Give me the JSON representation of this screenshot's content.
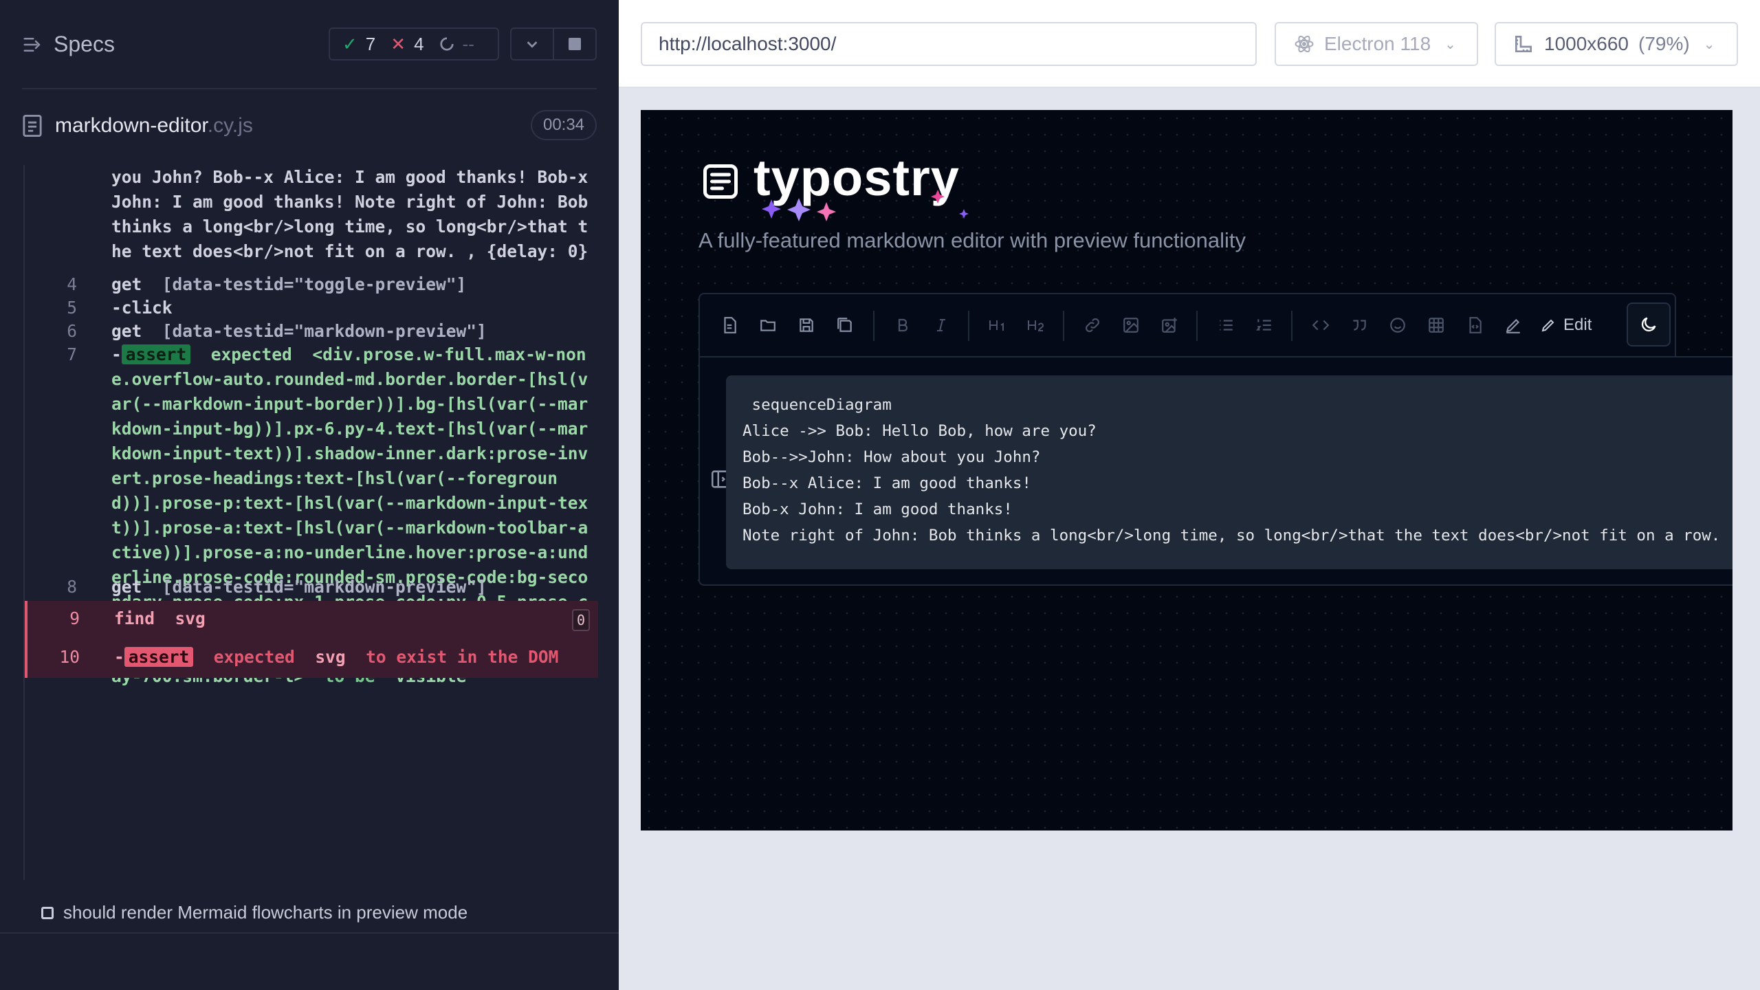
{
  "reporter": {
    "title": "Specs",
    "stats": {
      "passed": "7",
      "failed": "4",
      "pending": "--"
    },
    "file": {
      "name": "markdown-editor",
      "ext": ".cy.js",
      "duration": "00:34"
    },
    "commands": [
      {
        "text": "you John? Bob--x Alice: I am good thanks! Bob-x John: I am good thanks! Note right of John: Bob thinks a long<br/>long time, so long<br/>that the text does<br/>not fit on a row. , {delay: 0}"
      },
      {
        "num": "4",
        "name": "get",
        "arg": "[data-testid=\"toggle-preview\"]"
      },
      {
        "num": "5",
        "name": "-click"
      },
      {
        "num": "6",
        "name": "get",
        "arg": "[data-testid=\"markdown-preview\"]"
      },
      {
        "num": "7",
        "prefix": "-",
        "badge": "assert",
        "expected": "expected",
        "subject": "<div.prose.w-full.max-w-none.overflow-auto.rounded-md.border.border-[hsl(var(--markdown-input-border))].bg-[hsl(var(--markdown-input-bg))].px-6.py-4.text-[hsl(var(--markdown-input-text))].shadow-inner.dark:prose-invert.prose-headings:text-[hsl(var(--foreground))].prose-p:text-[hsl(var(--markdown-input-text))].prose-a:text-[hsl(var(--markdown-toolbar-active))].prose-a:no-underline.hover:prose-a:underline.prose-code:rounded-sm.prose-code:bg-secondary.prose-code:px-1.prose-code:py-0.5.prose-code:text-[hsl(var(--foreground))].prose-pre:bg-muted.prose-pre:shadow-sm.flex-1.dark:border-gray-700.sm:border-l>",
        "tobe": "to be",
        "state": "visible"
      },
      {
        "num": "8",
        "name": "get",
        "arg": "[data-testid=\"markdown-preview\"]"
      },
      {
        "num": "9",
        "name": "find",
        "arg": "svg",
        "count": "0"
      },
      {
        "num": "10",
        "prefix": "-",
        "badge": "assert",
        "expected": "expected",
        "subject": "svg",
        "rest": "to exist in the DOM"
      }
    ],
    "next_test": "should render Mermaid flowcharts in preview mode"
  },
  "browser": {
    "url": "http://localhost:3000/",
    "engine": "Electron 118",
    "viewport": "1000x660",
    "zoom": "(79%)"
  },
  "app": {
    "title": "typostry",
    "subtitle": "A fully-featured markdown editor with preview functionality",
    "toolbar": {
      "icons": [
        "new-file-icon",
        "open-folder-icon",
        "save-icon",
        "save-as-icon",
        "bold-icon",
        "italic-icon",
        "heading1-icon",
        "heading2-icon",
        "link-icon",
        "image-icon",
        "image-upload-icon",
        "bullet-list-icon",
        "numbered-list-icon",
        "code-icon",
        "quote-icon",
        "emoji-icon",
        "table-icon",
        "code-file-icon",
        "draw-icon"
      ],
      "edit_label": "Edit"
    },
    "code_lines": [
      " sequenceDiagram",
      "Alice ->> Bob: Hello Bob, how are you?",
      "Bob-->>John: How about you John?",
      "Bob--x Alice: I am good thanks!",
      "Bob-x John: I am good thanks!",
      "Note right of John: Bob thinks a long<br/>long time, so long<br/>that the text does<br/>not fit on a row."
    ]
  },
  "colors": {
    "reporter_bg": "#1b1e2e",
    "pass": "#1fa971",
    "fail": "#e45770",
    "app_bg": "#030712",
    "code_bg": "#1f2937"
  }
}
